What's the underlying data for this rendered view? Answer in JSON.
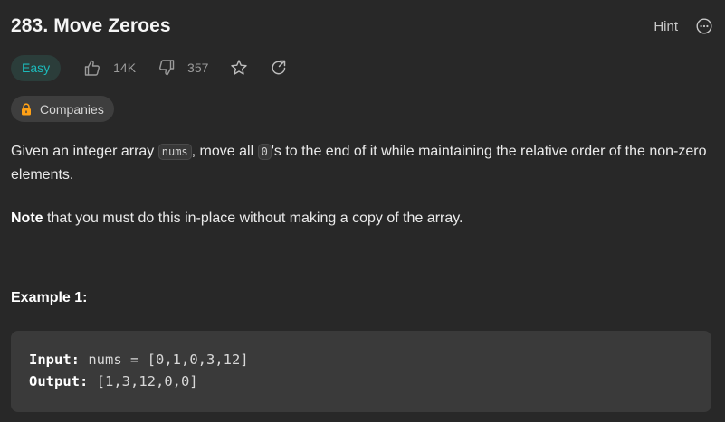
{
  "problem": {
    "title": "283. Move Zeroes",
    "difficulty": "Easy",
    "likes": "14K",
    "dislikes": "357",
    "companies_label": "Companies"
  },
  "header": {
    "hint_label": "Hint"
  },
  "description": {
    "part1": "Given an integer array ",
    "code1": "nums",
    "part2": ", move all ",
    "code2": "0",
    "part3": "'s to the end of it while maintaining the relative order of the non-zero elements.",
    "note_bold": "Note",
    "note_rest": " that you must do this in-place without making a copy of the array."
  },
  "example": {
    "title": "Example 1:",
    "input_label": "Input:",
    "input_value": " nums = [0,1,0,3,12]",
    "output_label": "Output:",
    "output_value": " [1,3,12,0,0]"
  },
  "colors": {
    "background": "#282828",
    "difficulty_easy": "#1cbaba",
    "chip_bg": "#3e3e3e",
    "lock": "#ffa116"
  },
  "icons": [
    "thumbs-up-icon",
    "thumbs-down-icon",
    "star-icon",
    "share-icon",
    "lock-icon",
    "more-icon"
  ]
}
